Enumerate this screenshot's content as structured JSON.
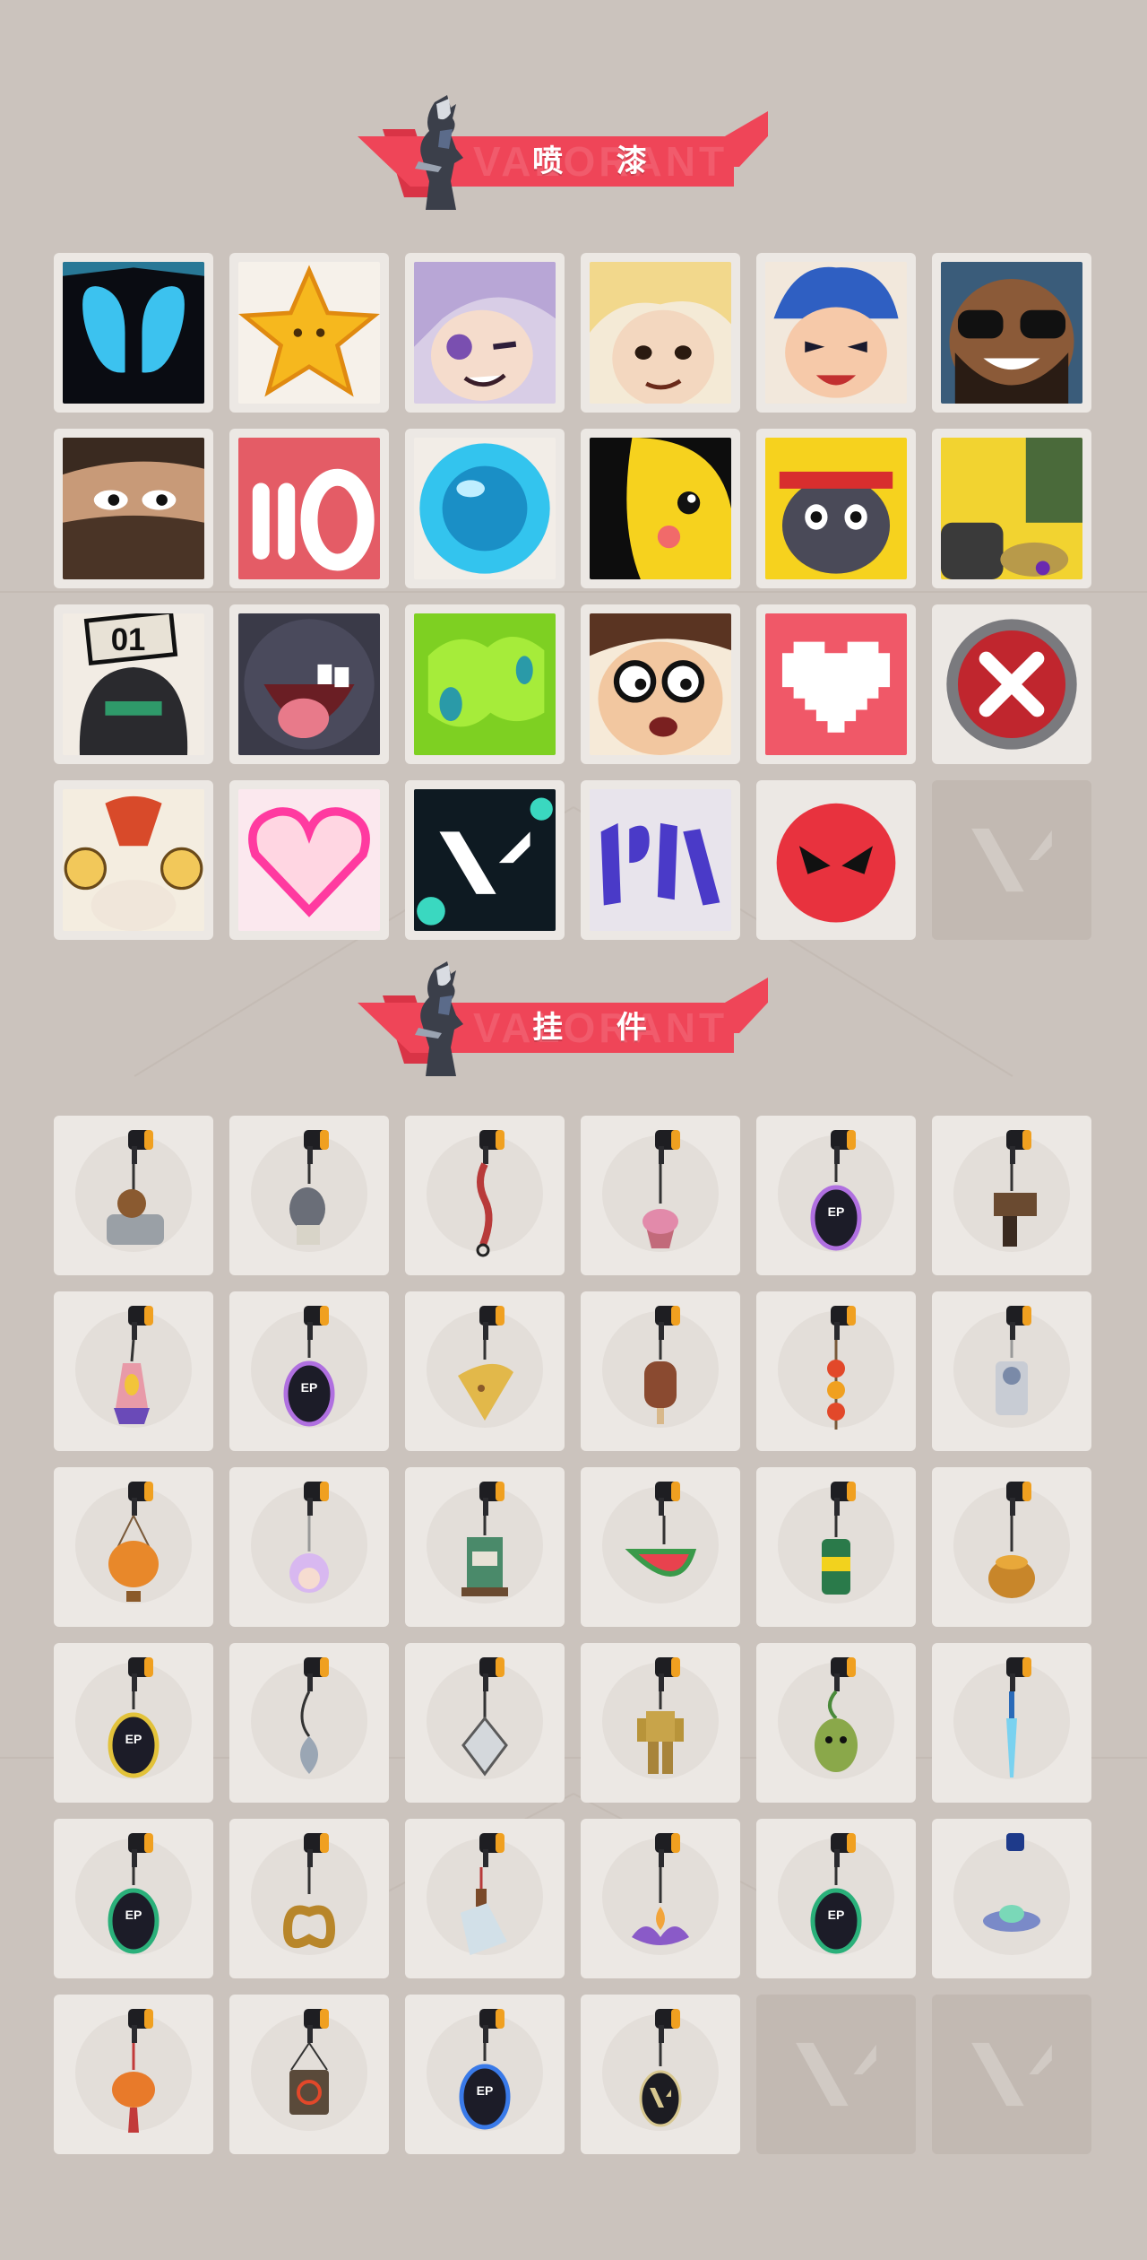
{
  "sections": {
    "sprays": {
      "title": "喷 漆",
      "watermark": "VALORANT"
    },
    "charms": {
      "title": "挂 件",
      "watermark": "VALORANT"
    }
  },
  "colors": {
    "background": "#cbc3bd",
    "banner_red": "#ef4558",
    "tile": "#ece8e4",
    "empty_tile": "#c2b9b2"
  },
  "sprays": [
    {
      "icon": "blue-teardrop-spray-icon"
    },
    {
      "icon": "gold-star-spray-icon"
    },
    {
      "icon": "lilac-hair-winking-girl-spray-icon"
    },
    {
      "icon": "blonde-agent-spray-icon"
    },
    {
      "icon": "blue-bandana-girl-spray-icon"
    },
    {
      "icon": "sunglasses-bearded-man-spray-icon"
    },
    {
      "icon": "bearded-agent-spray-icon"
    },
    {
      "icon": "bullets-zero-spray-icon"
    },
    {
      "icon": "blue-orb-spray-icon"
    },
    {
      "icon": "yellow-creature-spray-icon"
    },
    {
      "icon": "red-headband-critter-spray-icon"
    },
    {
      "icon": "explosive-fist-spray-icon"
    },
    {
      "icon": "number-01-masked-agent-spray-icon"
    },
    {
      "icon": "tongue-out-creature-spray-icon"
    },
    {
      "icon": "green-slime-spray-icon"
    },
    {
      "icon": "glasses-shocked-agent-spray-icon"
    },
    {
      "icon": "pixel-heart-spray-icon"
    },
    {
      "icon": "red-x-button-spray-icon"
    },
    {
      "icon": "elder-scrolls-sage-spray-icon"
    },
    {
      "icon": "neon-heart-spray-icon"
    },
    {
      "icon": "valorant-logo-splash-spray-icon"
    },
    {
      "icon": "graffiti-tag-spray-icon"
    },
    {
      "icon": "angry-red-circle-spray-icon"
    },
    {
      "icon": "empty-slot-icon"
    }
  ],
  "charms": [
    {
      "icon": "bathtub-critter-charm-icon"
    },
    {
      "icon": "armored-cat-charm-icon"
    },
    {
      "icon": "braided-cord-charm-icon"
    },
    {
      "icon": "cupcake-charm-icon"
    },
    {
      "icon": "ep9-medal-charm-icon"
    },
    {
      "icon": "pistol-charm-icon"
    },
    {
      "icon": "lava-lamp-charm-icon"
    },
    {
      "icon": "ep9-medal-charm-icon"
    },
    {
      "icon": "nacho-chip-charm-icon"
    },
    {
      "icon": "popsicle-charm-icon"
    },
    {
      "icon": "chili-skewer-charm-icon"
    },
    {
      "icon": "silver-agent-charm-icon"
    },
    {
      "icon": "hot-air-balloon-charm-icon"
    },
    {
      "icon": "pink-hair-doll-charm-icon"
    },
    {
      "icon": "coffee-machine-charm-icon"
    },
    {
      "icon": "watermelon-slice-charm-icon"
    },
    {
      "icon": "soda-can-charm-icon"
    },
    {
      "icon": "honey-pot-charm-icon"
    },
    {
      "icon": "ep9-medal-charm-icon"
    },
    {
      "icon": "silver-hook-charm-icon"
    },
    {
      "icon": "diamond-tag-charm-icon"
    },
    {
      "icon": "golden-robot-charm-icon"
    },
    {
      "icon": "green-plant-creature-charm-icon"
    },
    {
      "icon": "blue-blade-charm-icon"
    },
    {
      "icon": "ep8-medal-charm-icon"
    },
    {
      "icon": "pretzel-charm-icon"
    },
    {
      "icon": "bottle-charm-icon"
    },
    {
      "icon": "lotus-flame-charm-icon"
    },
    {
      "icon": "ep8-medal-charm-icon"
    },
    {
      "icon": "ufo-charm-icon"
    },
    {
      "icon": "orange-cat-tassel-charm-icon"
    },
    {
      "icon": "target-box-charm-icon"
    },
    {
      "icon": "ep8-medal-charm-icon"
    },
    {
      "icon": "valorant-logo-medal-charm-icon"
    },
    {
      "icon": "empty-slot-icon"
    },
    {
      "icon": "empty-slot-icon"
    }
  ]
}
